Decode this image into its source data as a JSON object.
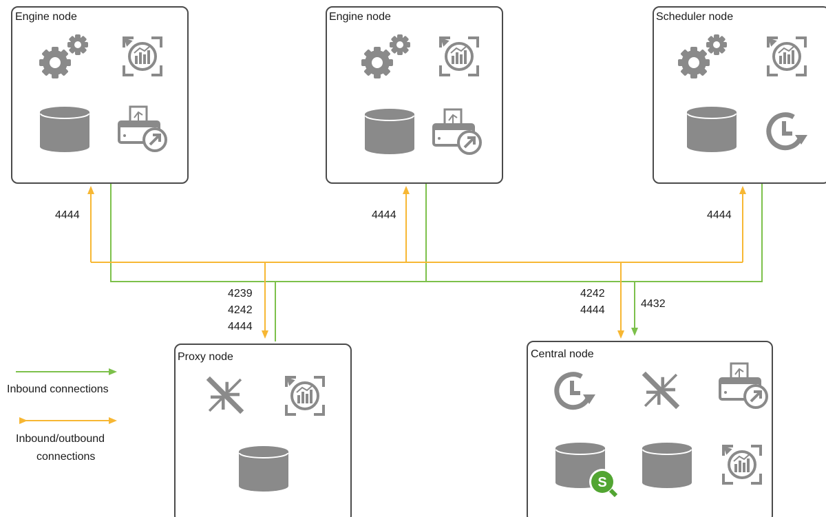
{
  "nodes": {
    "engine1": {
      "title": "Engine node"
    },
    "engine2": {
      "title": "Engine node"
    },
    "scheduler": {
      "title": "Scheduler node"
    },
    "proxy": {
      "title": "Proxy node"
    },
    "central": {
      "title": "Central node"
    }
  },
  "ports": {
    "engine1": "4444",
    "engine2": "4444",
    "scheduler": "4444",
    "proxy": [
      "4239",
      "4242",
      "4444"
    ],
    "central_bidir": [
      "4242",
      "4444"
    ],
    "central_inbound": "4432"
  },
  "legend": {
    "inbound": "Inbound connections",
    "bidirectional_line1": "Inbound/outbound",
    "bidirectional_line2": "connections"
  },
  "colors": {
    "inbound": "#7cc04a",
    "bidirectional": "#f7b733",
    "icon": "#8a8a8a",
    "qlik_badge": "#52a532"
  },
  "icons": {
    "engine1": [
      "gears-icon",
      "monitoring-icon",
      "database-icon",
      "printing-icon"
    ],
    "engine2": [
      "gears-icon",
      "monitoring-icon",
      "database-icon",
      "printing-icon"
    ],
    "scheduler": [
      "gears-icon",
      "monitoring-icon",
      "database-icon",
      "scheduler-icon"
    ],
    "proxy": [
      "proxy-icon",
      "monitoring-icon",
      "database-icon"
    ],
    "central": [
      "scheduler-icon",
      "proxy-icon",
      "printing-icon",
      "repository-database-icon",
      "database-icon",
      "monitoring-icon"
    ]
  }
}
